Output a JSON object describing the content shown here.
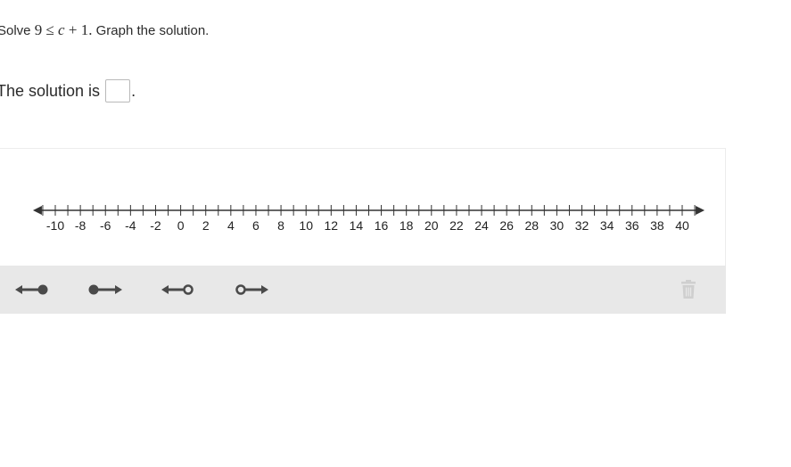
{
  "question": {
    "prefix": "Solve ",
    "math_lhs": "9",
    "math_rel": "≤",
    "math_var": "c",
    "math_op": "+",
    "math_const": "1",
    "math_end": ".",
    "suffix": " Graph the solution."
  },
  "answer": {
    "label": "The solution is",
    "value": "",
    "period": "."
  },
  "number_line": {
    "min": -11,
    "max": 41,
    "tick_step": 1,
    "labels": [
      -10,
      -8,
      -6,
      -4,
      -2,
      0,
      2,
      4,
      6,
      8,
      10,
      12,
      14,
      16,
      18,
      20,
      22,
      24,
      26,
      28,
      30,
      32,
      34,
      36,
      38,
      40
    ],
    "color": "#333333"
  },
  "toolbar": {
    "tools": [
      {
        "name": "ray-left-closed-tool",
        "direction": "left",
        "endpoint": "closed"
      },
      {
        "name": "ray-right-closed-tool",
        "direction": "right",
        "endpoint": "closed"
      },
      {
        "name": "ray-left-open-tool",
        "direction": "left",
        "endpoint": "open"
      },
      {
        "name": "ray-right-open-tool",
        "direction": "right",
        "endpoint": "open"
      }
    ],
    "tool_color": "#4a4a4a",
    "trash_icon": "trash-icon",
    "trash_color": "#cfcfcf",
    "background": "#e8e8e8"
  }
}
